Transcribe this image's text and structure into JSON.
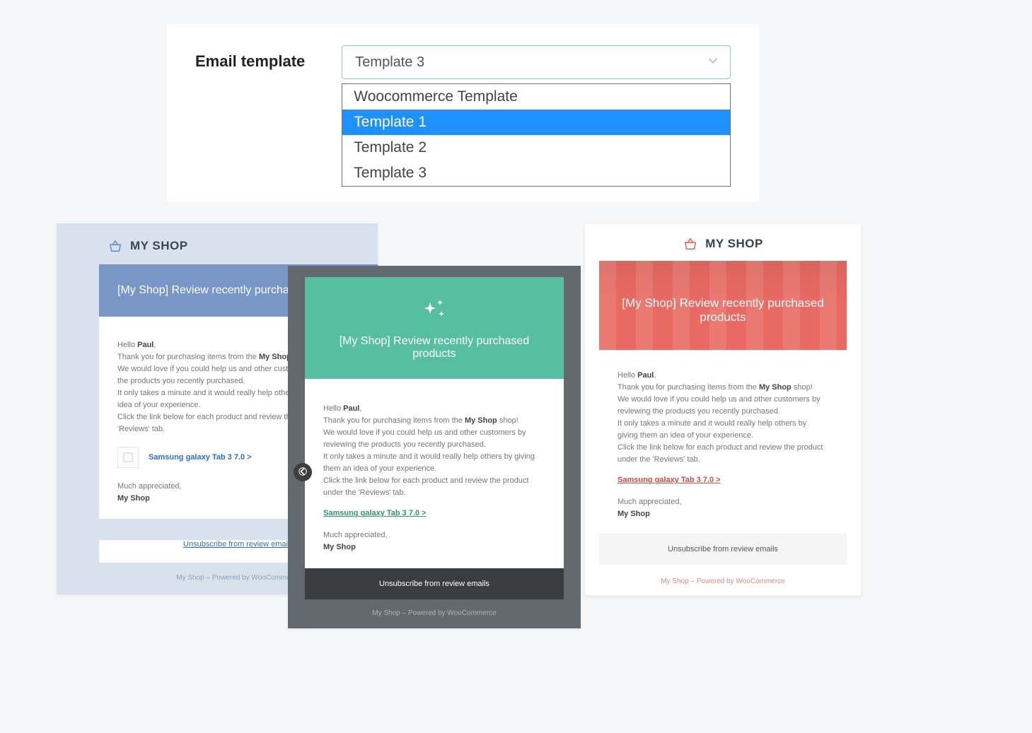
{
  "settings": {
    "label": "Email template",
    "selected_value": "Template 3",
    "options": [
      "Woocommerce Template",
      "Template 1",
      "Template 2",
      "Template 3"
    ],
    "highlighted_option_index": 1
  },
  "email_body": {
    "greeting_prefix": "Hello ",
    "recipient_name": "Paul",
    "line1_a": "Thank you for purchasing items from the ",
    "shop_strong": "My Shop",
    "line1_b": " shop!",
    "line2": "We would love if you could help us and other customers by reviewing the products you recently purchased.",
    "line3": "It only takes a minute and it would really help others by giving them an idea of your experience.",
    "line4": "Click the link below for each product and review the product under the 'Reviews' tab.",
    "product_link": "Samsung galaxy Tab 3 7.0 >",
    "signoff": "Much appreciated,",
    "shop_name": "My Shop"
  },
  "preview1": {
    "logo_text": "MY SHOP",
    "hero_title_visible": "[My Shop] Review recently purchased p",
    "unsubscribe": "Unsubscribe from review emails",
    "footer": "My Shop – Powered by WooCommerce",
    "accent": "#7897c7",
    "link_color": "#2f6fc1"
  },
  "preview2": {
    "hero_title": "[My Shop] Review recently purchased products",
    "unsubscribe": "Unsubscribe from review emails",
    "footer": "My Shop – Powered by WooCommerce",
    "accent": "#55bfa0",
    "link_color": "#2e9477"
  },
  "preview3": {
    "logo_text": "MY SHOP",
    "hero_title": "[My Shop] Review recently purchased products",
    "unsubscribe": "Unsubscribe from review emails",
    "footer": "My Shop – Powered by WooCommerce",
    "accent": "#e86a62",
    "link_color": "#d24b42"
  }
}
